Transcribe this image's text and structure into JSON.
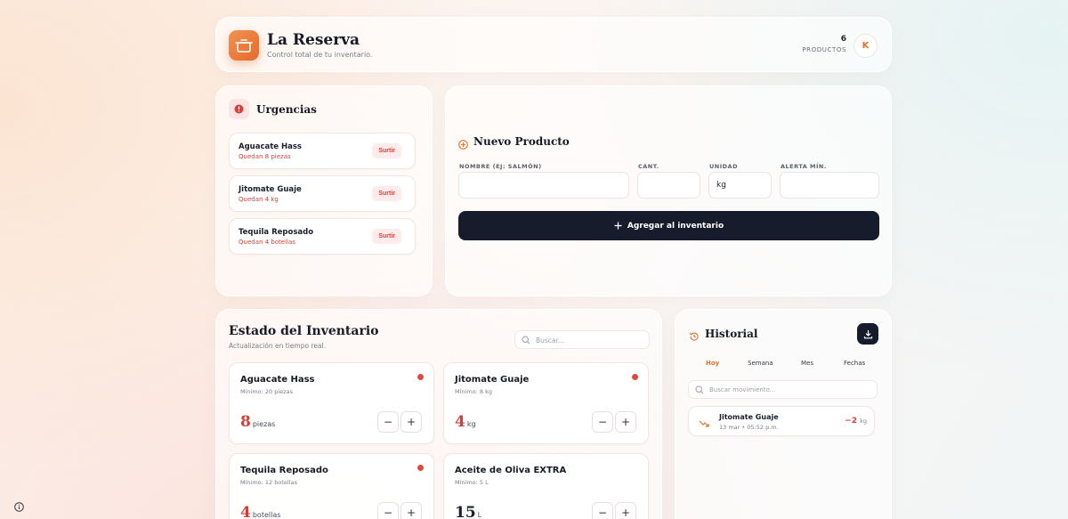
{
  "header": {
    "title": "La Reserva",
    "subtitle": "Control total de tu inventario.",
    "product_count": "6",
    "product_label": "PRODUCTOS",
    "avatar_initial": "K"
  },
  "urgencias": {
    "title": "Urgencias",
    "items": [
      {
        "name": "Aguacate Hass",
        "qty": "Quedan 8 piezas",
        "action": "Surtir"
      },
      {
        "name": "Jitomate Guaje",
        "qty": "Quedan 4 kg",
        "action": "Surtir"
      },
      {
        "name": "Tequila Reposado",
        "qty": "Quedan 4 botellas",
        "action": "Surtir"
      }
    ]
  },
  "nuevo": {
    "title": "Nuevo Producto",
    "labels": {
      "name": "NOMBRE (EJ: SALMÓN)",
      "qty": "CANT.",
      "unit": "UNIDAD",
      "alert": "ALERTA MÍN."
    },
    "values": {
      "name": "",
      "qty": "",
      "unit": "kg",
      "alert": ""
    },
    "add_label": "Agregar al inventario"
  },
  "inventario": {
    "title": "Estado del Inventario",
    "subtitle": "Actualización en tiempo real.",
    "search_placeholder": "Buscar...",
    "products": [
      {
        "name": "Aguacate Hass",
        "min": "Mínimo: 20 piezas",
        "qty": "8",
        "unit": "piezas"
      },
      {
        "name": "Jitomate Guaje",
        "min": "Mínimo: 8 kg",
        "qty": "4",
        "unit": "kg"
      },
      {
        "name": "Tequila Reposado",
        "min": "Mínimo: 12 botellas",
        "qty": "4",
        "unit": "botellas"
      },
      {
        "name": "Aceite de Oliva EXTRA",
        "min": "Mínimo: 5 L",
        "qty": "15",
        "unit": "L"
      }
    ],
    "minus": "−",
    "plus": "+"
  },
  "historial": {
    "title": "Historial",
    "tabs": [
      "Hoy",
      "Semana",
      "Mes",
      "Fechas"
    ],
    "active_tab": "Hoy",
    "search_placeholder": "Buscar movimiento...",
    "movements": [
      {
        "name": "Jitomate Guaje",
        "time": "13 mar • 05:52 p.m.",
        "value": "−2",
        "unit": "kg"
      }
    ]
  },
  "colors": {
    "accent": "#e56a2c",
    "danger": "#d6413a",
    "dark": "#161c2b"
  }
}
